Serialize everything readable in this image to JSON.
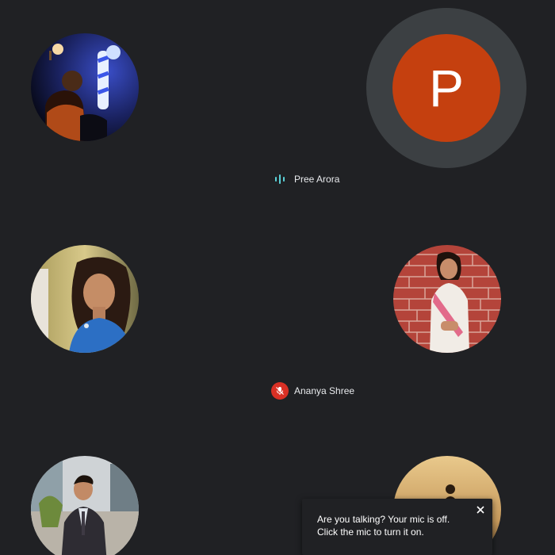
{
  "participants": [
    {
      "id": "tile-1",
      "type": "photo",
      "icon": "avatar-photo-barber-pole"
    },
    {
      "id": "tile-2",
      "type": "letter",
      "letter": "P",
      "name": "Pree Arora",
      "status": "speaking",
      "icon": "speaking-indicator-icon",
      "color": "#c5400f",
      "ring_color": "#3c4043",
      "indicator_color": "#5bd1d7"
    },
    {
      "id": "tile-3",
      "type": "photo",
      "icon": "avatar-photo-woman-blue-top"
    },
    {
      "id": "tile-4",
      "type": "photo",
      "name": "Ananya Shree",
      "status": "muted",
      "icon": "mic-off-icon",
      "badge_color": "#d93025"
    },
    {
      "id": "tile-5",
      "type": "photo",
      "icon": "avatar-photo-man-suit"
    },
    {
      "id": "tile-6",
      "type": "photo",
      "icon": "avatar-photo-silhouette-sunset"
    }
  ],
  "toast": {
    "message": "Are you talking? Your mic is off. Click the mic to turn it on.",
    "close_icon": "close-icon"
  },
  "theme": {
    "background": "#202124",
    "text": "#e8eaed"
  }
}
